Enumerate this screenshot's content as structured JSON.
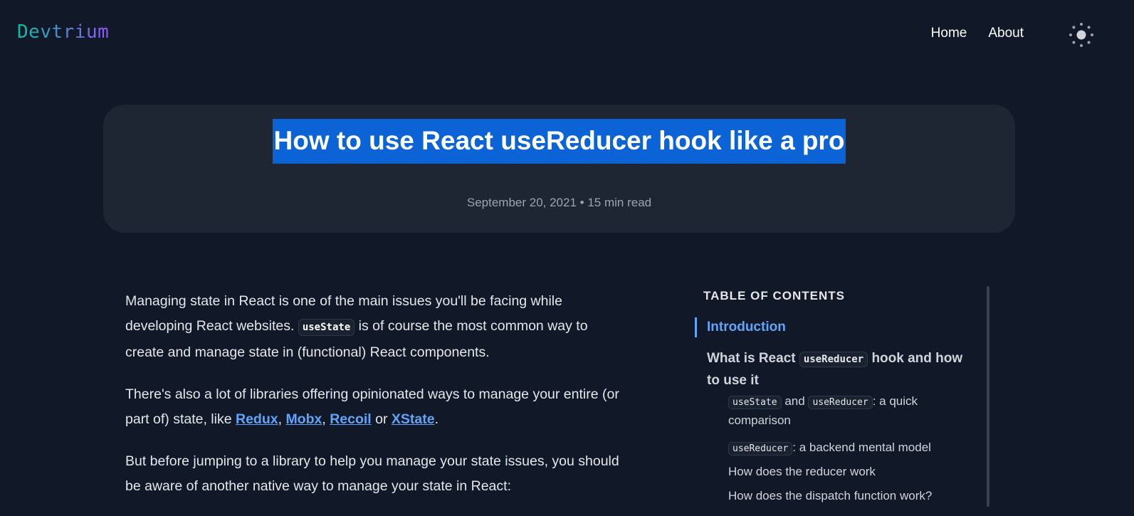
{
  "header": {
    "logo": "Devtrium",
    "logo_gradient": [
      "#14b8a6",
      "#8b5cf6"
    ],
    "nav": [
      {
        "label": "Home"
      },
      {
        "label": "About"
      }
    ],
    "theme_toggle_icon": "sun-icon"
  },
  "hero": {
    "title": "How to use React useReducer hook like a pro",
    "date": "September 20, 2021",
    "separator": "•",
    "read_time": "15 min read",
    "selection_color": "#0b63d6"
  },
  "article": {
    "p1": {
      "t1": "Managing state in React is one of the main issues you'll be facing while developing React websites. ",
      "code": "useState",
      "t2": " is of course the most common way to create and manage state in (functional) React components."
    },
    "p2": {
      "t1": "There's also a lot of libraries offering opinionated ways to manage your entire (or part of) state, like ",
      "links": [
        "Redux",
        "Mobx",
        "Recoil",
        "XState"
      ],
      "sep1": ", ",
      "sep2": ", ",
      "sep3": " or ",
      "end": "."
    },
    "p3": {
      "t1": "But before jumping to a library to help you manage your state issues, you should be aware of another native way to manage your state in React:"
    }
  },
  "toc": {
    "heading": "TABLE OF CONTENTS",
    "items": [
      {
        "label": "Introduction",
        "active": true
      },
      {
        "pre": "What is React ",
        "code": "useReducer",
        "post": " hook and how to use it"
      }
    ],
    "subitems": [
      {
        "code1": "useState",
        "mid": " and ",
        "code2": "useReducer",
        "post": ": a quick comparison"
      },
      {
        "code": "useReducer",
        "post": ": a backend mental model"
      },
      {
        "label": "How does the reducer work"
      },
      {
        "label": "How does the dispatch function work?"
      }
    ],
    "accent_color": "#60a5fa"
  }
}
